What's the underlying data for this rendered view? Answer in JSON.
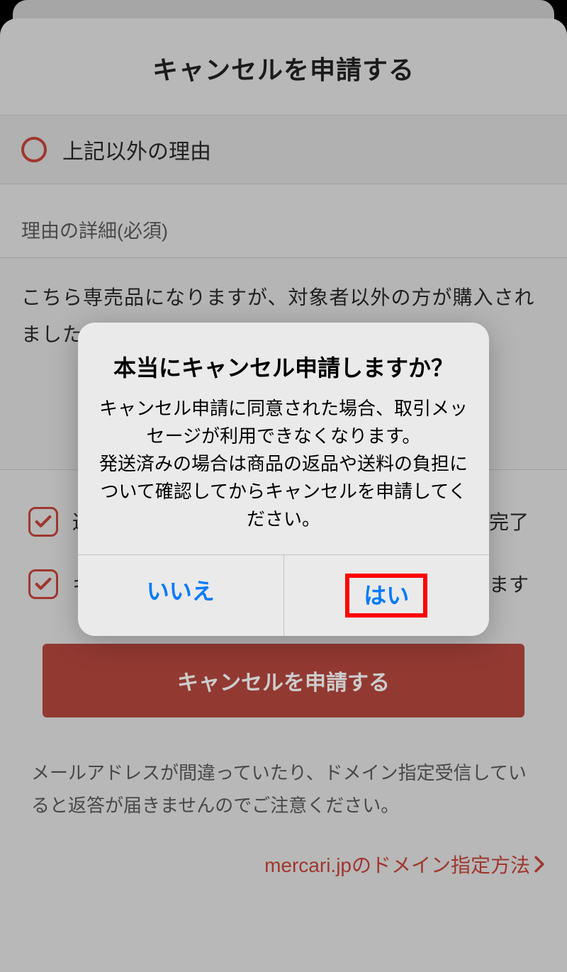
{
  "header": {
    "title": "キャンセルを申請する"
  },
  "reason": {
    "label": "上記以外の理由"
  },
  "detail": {
    "section_label": "理由の詳細(必須)",
    "text": "こちら専売品になりますが、対象者以外の方が購入されましたのでキャンセルさせていただきます"
  },
  "checks": [
    {
      "text_prefix": "返",
      "text_suffix": "を完了"
    },
    {
      "text_prefix": "キ",
      "text_suffix": "なります"
    }
  ],
  "primary_button": "キャンセルを申請する",
  "note": "メールアドレスが間違っていたり、ドメイン指定受信していると返答が届きませんのでご注意ください。",
  "link": "mercari.jpのドメイン指定方法",
  "dialog": {
    "title": "本当にキャンセル申請しますか？",
    "message": "キャンセル申請に同意された場合、取引メッセージが利用できなくなります。\n発送済みの場合は商品の返品や送料の負担について確認してからキャンセルを申請してください。",
    "no": "いいえ",
    "yes": "はい"
  }
}
